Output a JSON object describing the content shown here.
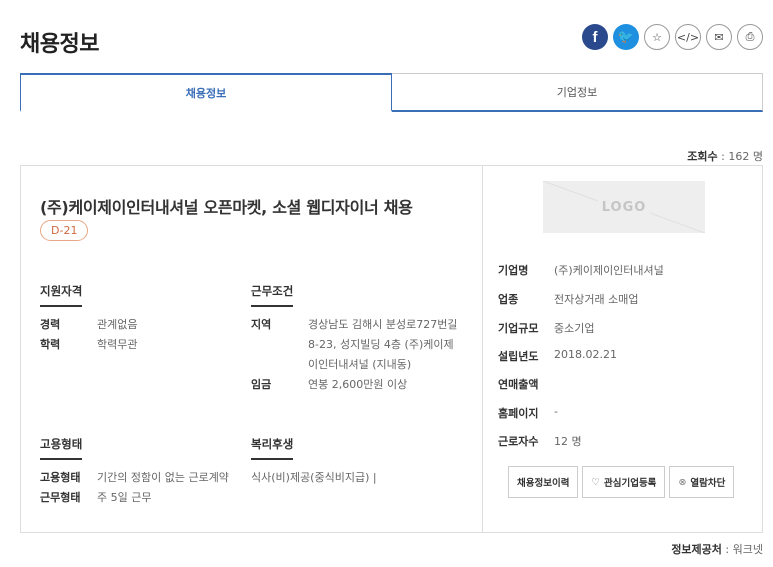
{
  "page": {
    "title": "채용정보"
  },
  "share": {
    "facebook": "f",
    "twitter": "🐦",
    "bookmark": "☆",
    "embed": "</>",
    "mail": "✉",
    "print": "⎙"
  },
  "tabs": [
    {
      "label": "채용정보",
      "active": true
    },
    {
      "label": "기업정보",
      "active": false
    }
  ],
  "views": {
    "label": "조회수",
    "value": "162 명"
  },
  "job": {
    "title": "(주)케이제이인터내셔널 오픈마켓, 소셜 웹디자이너 채용",
    "dday": "D-21"
  },
  "qualification": {
    "heading": "지원자격",
    "rows": [
      {
        "k": "경력",
        "v": "관계없음"
      },
      {
        "k": "학력",
        "v": "학력무관"
      }
    ]
  },
  "conditions": {
    "heading": "근무조건",
    "location_label": "지역",
    "location_lines": [
      "경상남도 김해시 분성로727번길",
      "8-23, 성지빌딩 4층 (주)케이제",
      "이인터내셔널 (지내동)"
    ],
    "salary_label": "임금",
    "salary": "연봉 2,600만원 이상"
  },
  "employment": {
    "heading": "고용형태",
    "rows": [
      {
        "k": "고용형태",
        "v": "기간의 정함이 없는 근로계약"
      },
      {
        "k": "근무형태",
        "v": "주 5일 근무"
      }
    ]
  },
  "welfare": {
    "heading": "복리후생",
    "text": "식사(비)제공(중식비지급) |"
  },
  "company": {
    "logo": "LOGO",
    "rows": [
      {
        "k": "기업명",
        "v": "(주)케이제이인터내셔널"
      },
      {
        "k": "업종",
        "v": "전자상거래 소매업"
      },
      {
        "k": "기업규모",
        "v": "중소기업"
      },
      {
        "k": "설립년도",
        "v": "2018.02.21"
      },
      {
        "k": "연매출액",
        "v": ""
      },
      {
        "k": "홈페이지",
        "v": "-"
      },
      {
        "k": "근로자수",
        "v": "12 명"
      }
    ]
  },
  "actions": {
    "history": "채용정보이력",
    "interest_icon": "♡",
    "interest": "관심기업등록",
    "block_icon": "⊗",
    "block": "열람차단"
  },
  "source": {
    "label": "정보제공처",
    "value": "워크넷"
  }
}
